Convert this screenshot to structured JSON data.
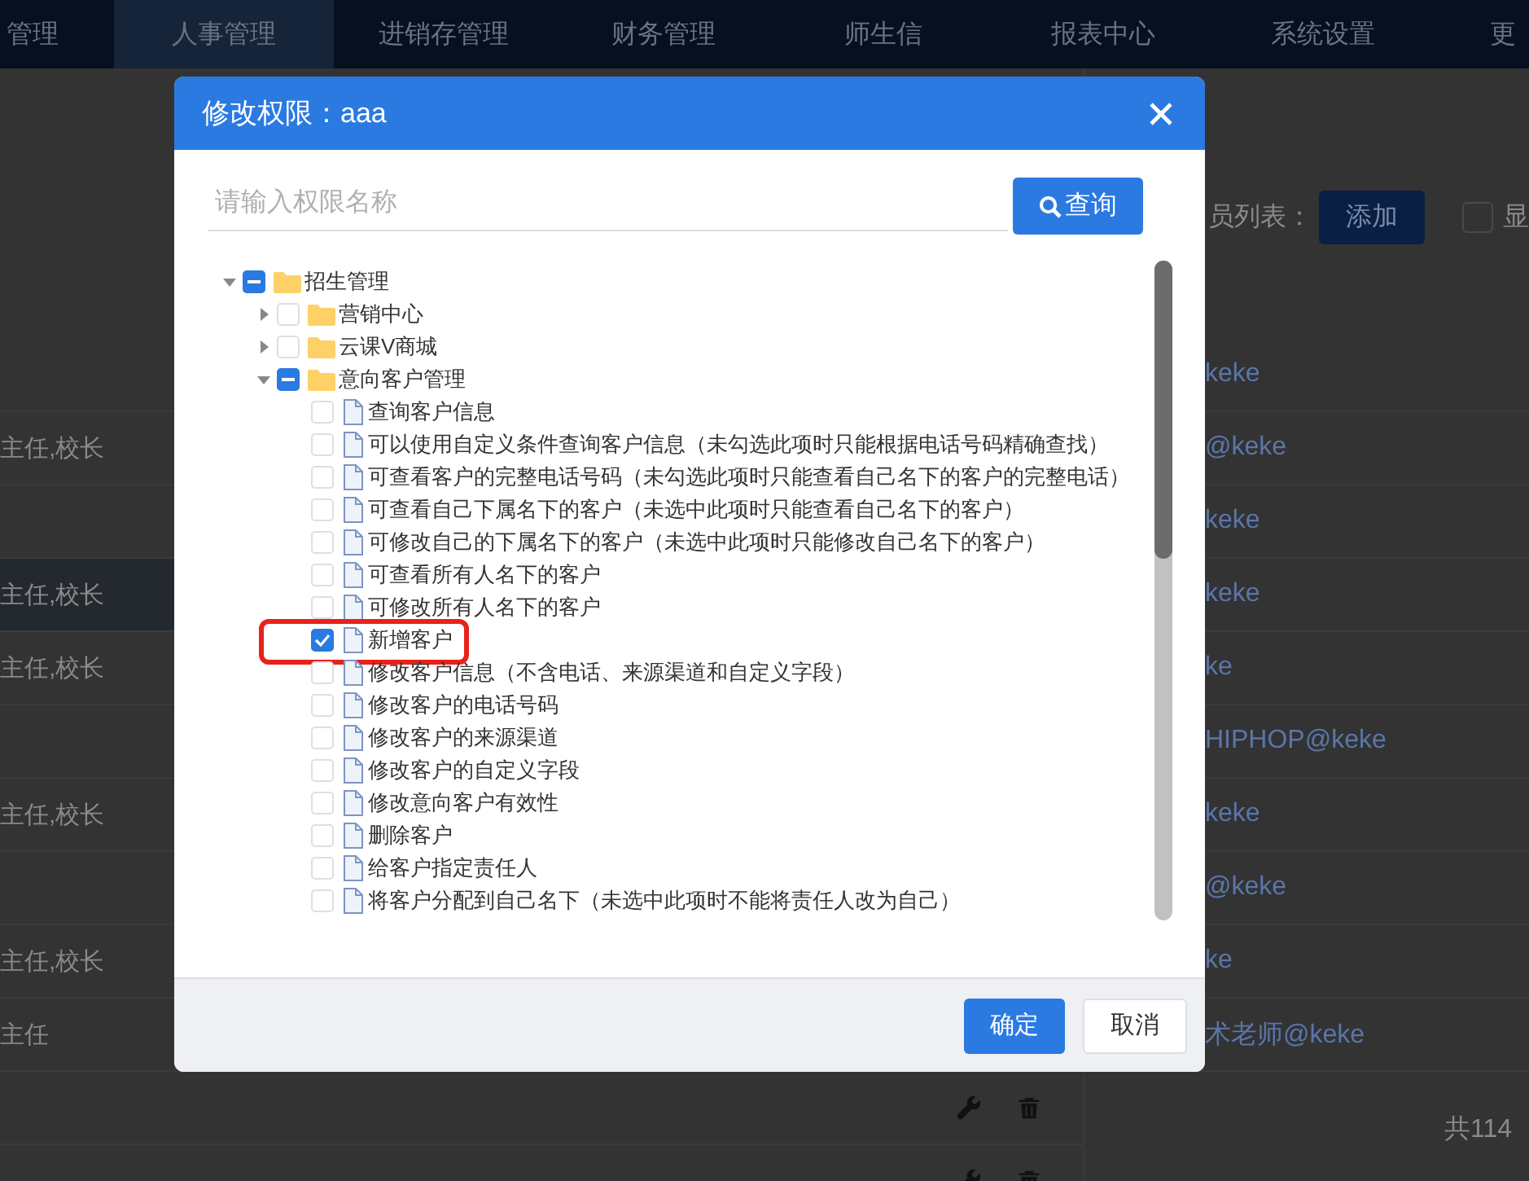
{
  "nav": {
    "items": [
      {
        "label": "管理",
        "selected": false
      },
      {
        "label": "人事管理",
        "selected": true
      },
      {
        "label": "进销存管理",
        "selected": false
      },
      {
        "label": "财务管理",
        "selected": false
      },
      {
        "label": "师生信",
        "selected": false
      },
      {
        "label": "报表中心",
        "selected": false
      },
      {
        "label": "系统设置",
        "selected": false
      },
      {
        "label": "更",
        "selected": false
      }
    ]
  },
  "staff_table": {
    "rows": [
      {
        "selected": false
      },
      {
        "roles": "主任,校长",
        "selected": false
      },
      {
        "selected": false
      },
      {
        "roles": "主任,校长",
        "selected": true
      },
      {
        "roles": "主任,校长",
        "selected": false
      },
      {
        "selected": false
      },
      {
        "roles": "主任,校长",
        "selected": false
      },
      {
        "selected": false
      },
      {
        "roles": "主任,校长",
        "selected": false
      },
      {
        "roles": "主任",
        "selected": false
      },
      {
        "selected": false
      },
      {
        "selected": false
      }
    ]
  },
  "member_panel": {
    "title": "员列表：",
    "add_button": "添加",
    "show_checkbox": {
      "label": "显",
      "checked": false
    },
    "rows": [
      {
        "name": "keke"
      },
      {
        "name": "@keke"
      },
      {
        "name": "keke"
      },
      {
        "name": "keke"
      },
      {
        "name": "ke"
      },
      {
        "name": "HIPHOP@keke"
      },
      {
        "name": "keke"
      },
      {
        "name": "@keke"
      },
      {
        "name": "ke"
      },
      {
        "name": "术老师@keke"
      }
    ],
    "total": "共114"
  },
  "dialog": {
    "title": "修改权限：aaa",
    "search": {
      "placeholder": "请输入权限名称",
      "button": "查询"
    },
    "tree": [
      {
        "label": "招生管理",
        "kind": "folder",
        "checked": false,
        "indeterminate": true,
        "expanded": true,
        "children": [
          {
            "label": "营销中心",
            "kind": "folder",
            "checked": false,
            "indeterminate": false,
            "expanded": false
          },
          {
            "label": "云课V商城",
            "kind": "folder",
            "checked": false,
            "indeterminate": false,
            "expanded": false
          },
          {
            "label": "意向客户管理",
            "kind": "folder",
            "checked": false,
            "indeterminate": true,
            "expanded": true,
            "children": [
              {
                "label": "查询客户信息",
                "kind": "file",
                "checked": false,
                "highlighted": false
              },
              {
                "label": "可以使用自定义条件查询客户信息（未勾选此项时只能根据电话号码精确查找）",
                "kind": "file",
                "checked": false,
                "highlighted": false
              },
              {
                "label": "可查看客户的完整电话号码（未勾选此项时只能查看自己名下的客户的完整电话）",
                "kind": "file",
                "checked": false,
                "highlighted": false
              },
              {
                "label": "可查看自己下属名下的客户（未选中此项时只能查看自己名下的客户）",
                "kind": "file",
                "checked": false,
                "highlighted": false
              },
              {
                "label": "可修改自己的下属名下的客户（未选中此项时只能修改自己名下的客户）",
                "kind": "file",
                "checked": false,
                "highlighted": false
              },
              {
                "label": "可查看所有人名下的客户",
                "kind": "file",
                "checked": false,
                "highlighted": false
              },
              {
                "label": "可修改所有人名下的客户",
                "kind": "file",
                "checked": false,
                "highlighted": false
              },
              {
                "label": "新增客户",
                "kind": "file",
                "checked": true,
                "highlighted": true
              },
              {
                "label": "修改客户信息（不含电话、来源渠道和自定义字段）",
                "kind": "file",
                "checked": false,
                "highlighted": false
              },
              {
                "label": "修改客户的电话号码",
                "kind": "file",
                "checked": false,
                "highlighted": false
              },
              {
                "label": "修改客户的来源渠道",
                "kind": "file",
                "checked": false,
                "highlighted": false
              },
              {
                "label": "修改客户的自定义字段",
                "kind": "file",
                "checked": false,
                "highlighted": false
              },
              {
                "label": "修改意向客户有效性",
                "kind": "file",
                "checked": false,
                "highlighted": false
              },
              {
                "label": "删除客户",
                "kind": "file",
                "checked": false,
                "highlighted": false
              },
              {
                "label": "给客户指定责任人",
                "kind": "file",
                "checked": false,
                "highlighted": false
              },
              {
                "label": "将客户分配到自己名下（未选中此项时不能将责任人改为自己）",
                "kind": "file",
                "checked": false,
                "highlighted": false
              }
            ]
          }
        ]
      }
    ],
    "buttons": [
      {
        "label": "确定",
        "kind": "primary"
      },
      {
        "label": "取消",
        "kind": "default"
      }
    ]
  }
}
